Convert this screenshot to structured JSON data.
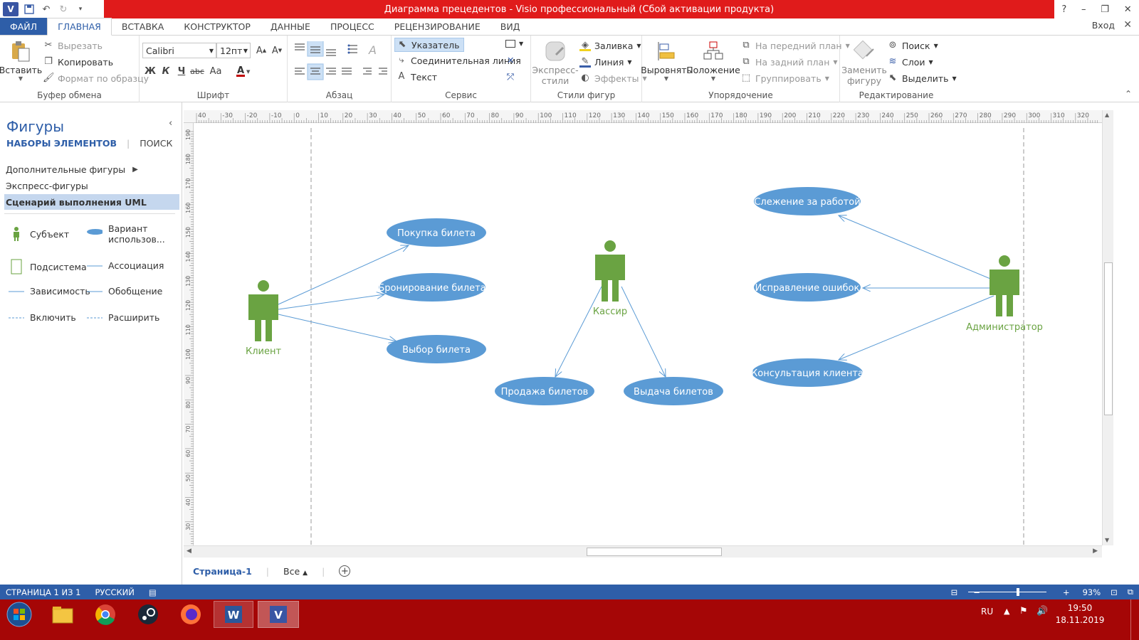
{
  "titlebar": {
    "title": "Диаграмма прецедентов -  Visio профессиональный (Сбой активации продукта)",
    "controls": [
      "?",
      "–",
      "❐",
      "✕"
    ]
  },
  "tabs": [
    "ФАЙЛ",
    "ГЛАВНАЯ",
    "ВСТАВКА",
    "КОНСТРУКТОР",
    "ДАННЫЕ",
    "ПРОЦЕСС",
    "РЕЦЕНЗИРОВАНИЕ",
    "ВИД"
  ],
  "signin": "Вход",
  "ribbon": {
    "clipboard": {
      "label": "Буфер обмена",
      "paste": "Вставить",
      "cut": "Вырезать",
      "copy": "Копировать",
      "format": "Формат по образцу"
    },
    "font": {
      "label": "Шрифт",
      "family": "Calibri",
      "size": "12пт",
      "bold": "Ж",
      "italic": "К",
      "underline": "Ч",
      "strike": "abc",
      "case": "Aa"
    },
    "paragraph": {
      "label": "Абзац"
    },
    "tools": {
      "label": "Сервис",
      "pointer": "Указатель",
      "connector": "Соединительная линия",
      "text": "Текст"
    },
    "shapestyles": {
      "label": "Стили фигур",
      "quick1": "Экспресс-",
      "quick2": "стили",
      "fill": "Заливка",
      "line": "Линия",
      "effects": "Эффекты"
    },
    "arrange": {
      "label": "Упорядочение",
      "align": "Выровнять",
      "position": "Положение",
      "front": "На передний план",
      "back": "На задний план",
      "group": "Группировать"
    },
    "editing": {
      "label": "Редактирование",
      "change1": "Заменить",
      "change2": "фигуру",
      "find": "Поиск",
      "layers": "Слои",
      "select": "Выделить"
    }
  },
  "pane": {
    "title": "Фигуры",
    "tab_stencils": "НАБОРЫ ЭЛЕМЕНТОВ",
    "tab_search": "ПОИСК",
    "stencils": [
      "Дополнительные фигуры",
      "Экспресс-фигуры",
      "Сценарий выполнения UML"
    ],
    "masters": [
      "Субъект",
      "Вариант использов...",
      "Подсистема",
      "Ассоциация",
      "Зависимость",
      "Обобщение",
      "Включить",
      "Расширить"
    ],
    "master_line1": "Вариант",
    "master_line2": "использов..."
  },
  "ruler": {
    "h_labels": [
      "40",
      "-30",
      "-20",
      "-10",
      "0",
      "10",
      "20",
      "30",
      "40",
      "50",
      "60",
      "70",
      "80",
      "90",
      "100",
      "110",
      "120",
      "130",
      "140",
      "150",
      "160",
      "170",
      "180",
      "190",
      "200",
      "210",
      "220",
      "230",
      "240",
      "250",
      "260",
      "270",
      "280",
      "290",
      "300",
      "310",
      "320"
    ],
    "v_labels": [
      "190",
      "180",
      "170",
      "160",
      "150",
      "140",
      "130",
      "120",
      "110",
      "100",
      "90",
      "80",
      "70",
      "60",
      "50",
      "40",
      "30"
    ]
  },
  "diagram": {
    "actors": [
      "Клиент",
      "Кассир",
      "Администратор"
    ],
    "usecases": [
      "Покупка билета",
      "Бронирование билета",
      "Выбор билета",
      "Продажа билетов",
      "Выдача билетов",
      "Слежение за работой",
      "Исправление ошибок",
      "Консультация клиента"
    ],
    "colors": {
      "actor": "#6aa342",
      "usecase": "#5b9bd5",
      "line": "#5b9bd5"
    }
  },
  "pagetabs": {
    "page": "Страница-1",
    "all": "Все"
  },
  "status": {
    "page": "СТРАНИЦА 1 ИЗ 1",
    "lang": "РУССКИЙ",
    "zoom": "93%"
  },
  "taskbar": {
    "lang": "RU",
    "time": "19:50",
    "date": "18.11.2019"
  }
}
